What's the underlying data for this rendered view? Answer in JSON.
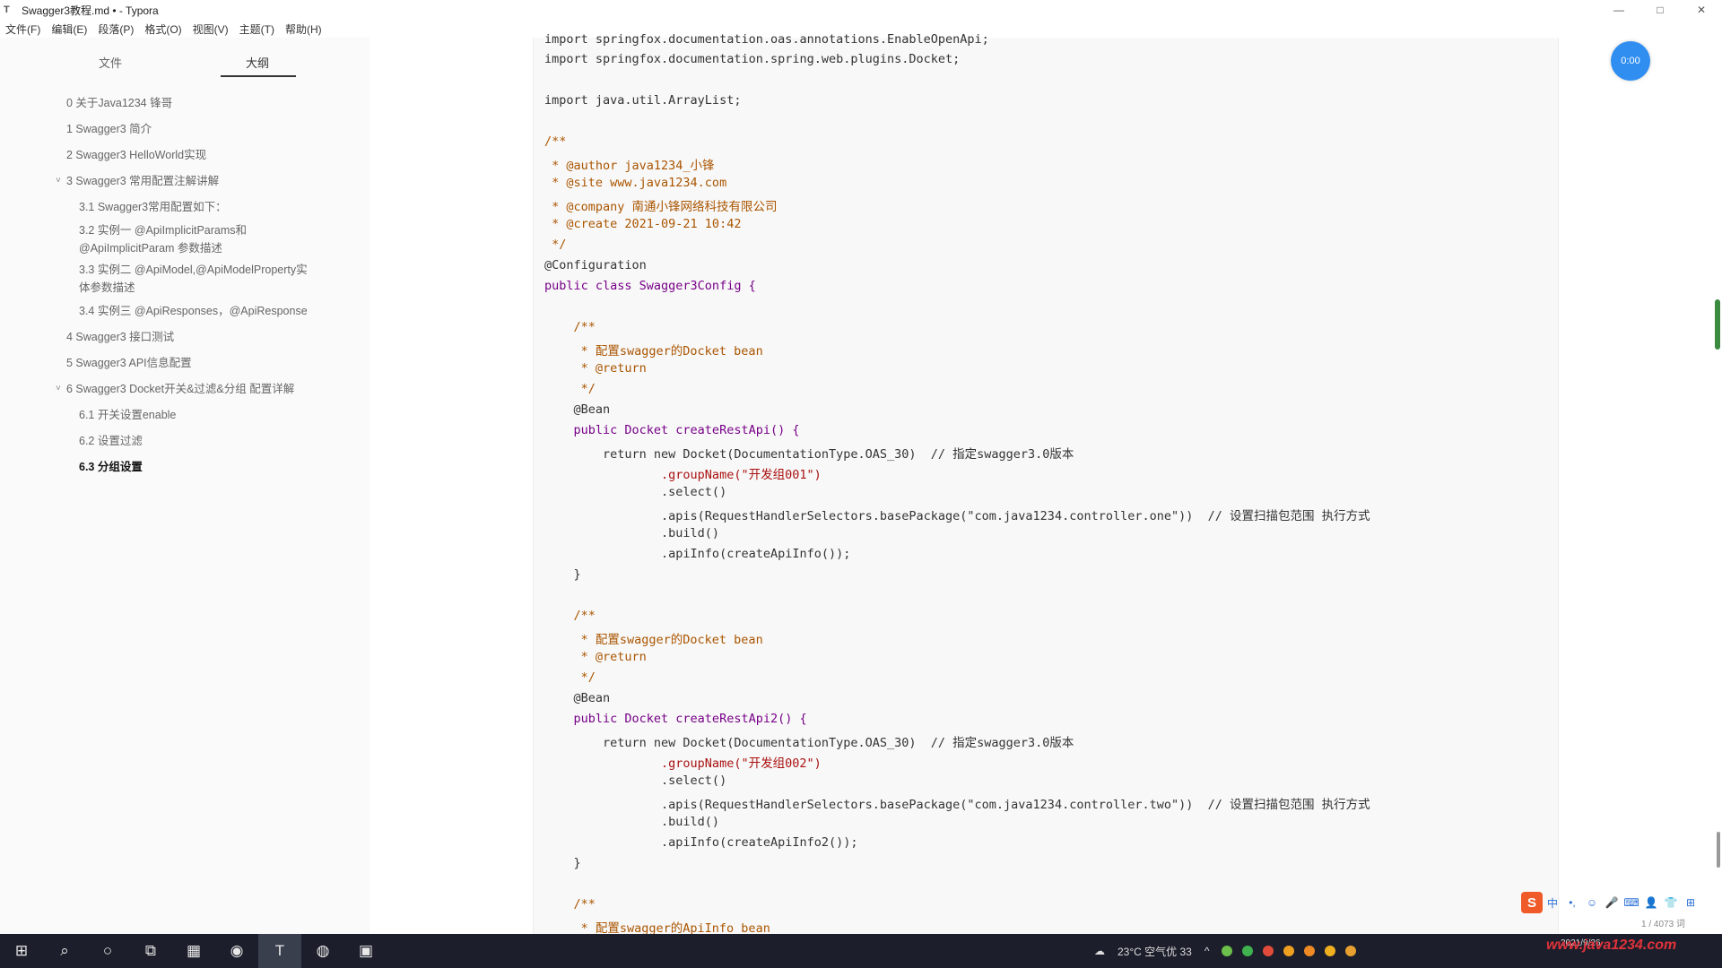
{
  "window": {
    "title": "Swagger3教程.md • - Typora",
    "controls": [
      "—",
      "□",
      "✕"
    ]
  },
  "menu": [
    "文件(F)",
    "编辑(E)",
    "段落(P)",
    "格式(O)",
    "视图(V)",
    "主题(T)",
    "帮助(H)"
  ],
  "sidebar": {
    "tabs": [
      "文件",
      "大纲"
    ],
    "items": [
      {
        "label": "0 关于Java1234 锋哥"
      },
      {
        "label": "1 Swagger3 简介"
      },
      {
        "label": "2 Swagger3 HelloWorld实现"
      },
      {
        "label": "3 Swagger3 常用配置注解讲解"
      },
      {
        "label": "3.1 Swagger3常用配置如下："
      },
      {
        "label": "3.2 实例一 @ApiImplicitParams和"
      },
      {
        "label": "@ApiImplicitParam 参数描述"
      },
      {
        "label": "3.3 实例二 @ApiModel,@ApiModelProperty实"
      },
      {
        "label": "体参数描述"
      },
      {
        "label": "3.4 实例三 @ApiResponses，@ApiResponse"
      },
      {
        "label": "4 Swagger3 接口测试"
      },
      {
        "label": "5 Swagger3 API信息配置"
      },
      {
        "label": "6 Swagger3 Docket开关&过滤&分组 配置详解"
      },
      {
        "label": "6.1 开关设置enable"
      },
      {
        "label": "6.2 设置过滤"
      },
      {
        "label": "6.3 分组设置"
      }
    ],
    "footer": [
      "‹",
      "</>"
    ]
  },
  "code": {
    "lines": [
      "import springfox.documentation.oas.annotations.EnableOpenApi;",
      "import springfox.documentation.spring.web.plugins.Docket;",
      "",
      "import java.util.ArrayList;",
      "",
      "/**",
      " * @author java1234_小锋",
      " * @site www.java1234.com",
      " * @company 南通小锋网络科技有限公司",
      " * @create 2021-09-21 10:42",
      " */",
      "@Configuration",
      "public class Swagger3Config {",
      "",
      "    /**",
      "     * 配置swagger的Docket bean",
      "     * @return",
      "     */",
      "    @Bean",
      "    public Docket createRestApi() {",
      "        return new Docket(DocumentationType.OAS_30)  // 指定swagger3.0版本",
      "                .groupName(\"开发组001\")",
      "                .select()",
      "                .apis(RequestHandlerSelectors.basePackage(\"com.java1234.controller.one\"))  // 设置扫描包范围 执行方式",
      "                .build()",
      "                .apiInfo(createApiInfo());",
      "    }",
      "",
      "    /**",
      "     * 配置swagger的Docket bean",
      "     * @return",
      "     */",
      "    @Bean",
      "    public Docket createRestApi2() {",
      "        return new Docket(DocumentationType.OAS_30)  // 指定swagger3.0版本",
      "                .groupName(\"开发组002\")",
      "                .select()",
      "                .apis(RequestHandlerSelectors.basePackage(\"com.java1234.controller.two\"))  // 设置扫描包范围 执行方式",
      "                .build()",
      "                .apiInfo(createApiInfo2());",
      "    }",
      "",
      "    /**",
      "     * 配置swagger的ApiInfo bean"
    ]
  },
  "avatar": {
    "label": "0:00"
  },
  "ime": {
    "logo": "S",
    "icons": [
      "中",
      "•,",
      "☺",
      "🎤",
      "⌨",
      "👤",
      "👕",
      "⊞"
    ]
  },
  "status": {
    "word_count": "1 / 4073 词"
  },
  "taskbar": {
    "weather": "23°C 空气优 33",
    "clock_time": "",
    "clock_date": "2021/9/26"
  },
  "watermark": "www.java1234.com"
}
